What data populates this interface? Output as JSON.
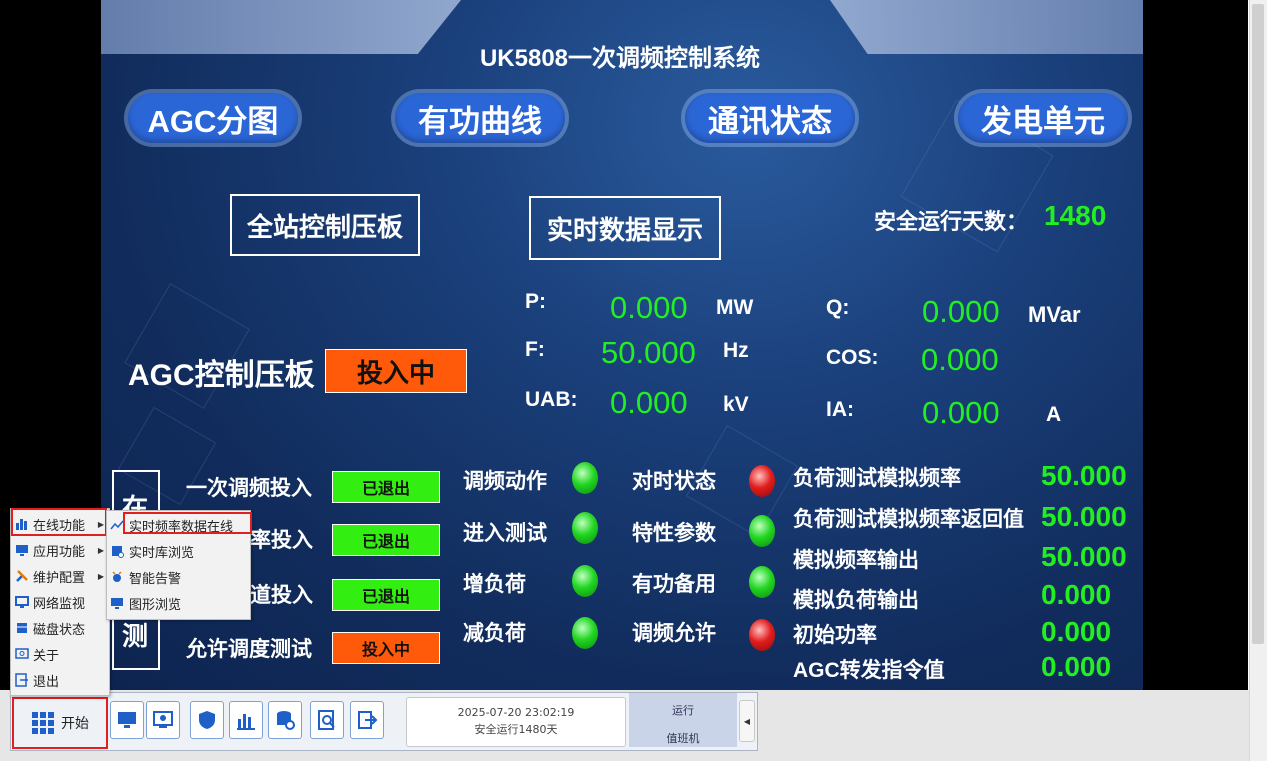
{
  "title": "UK5808一次调频控制系统",
  "nav": [
    "AGC分图",
    "有功曲线",
    "通讯状态",
    "发电单元"
  ],
  "panels": {
    "station_panel": "全站控制压板",
    "realtime_display": "实时数据显示"
  },
  "safe_days": {
    "label": "安全运行天数：",
    "value": "1480"
  },
  "agc": {
    "label": "AGC控制压板",
    "status": "投入中"
  },
  "measurements": {
    "p": {
      "label": "P:",
      "value": "0.000",
      "unit": "MW"
    },
    "f": {
      "label": "F:",
      "value": "50.000",
      "unit": "Hz"
    },
    "uab": {
      "label": "UAB:",
      "value": "0.000",
      "unit": "kV"
    },
    "q": {
      "label": "Q:",
      "value": "0.000",
      "unit": "MVar"
    },
    "cos": {
      "label": "COS:",
      "value": "0.000"
    },
    "ia": {
      "label": "IA:",
      "value": "0.000",
      "unit": "A"
    }
  },
  "vertical_label": [
    "在",
    "测"
  ],
  "switches": [
    {
      "label": "一次调频投入",
      "status": "已退出"
    },
    {
      "label": "率投入",
      "status": "已退出"
    },
    {
      "label": "道投入",
      "status": "已退出"
    },
    {
      "label": "允许调度测试",
      "status": "投入中"
    }
  ],
  "indicators_left": [
    {
      "label": "调频动作",
      "state": "green"
    },
    {
      "label": "进入测试",
      "state": "green"
    },
    {
      "label": "增负荷",
      "state": "green"
    },
    {
      "label": "减负荷",
      "state": "green"
    }
  ],
  "indicators_right": [
    {
      "label": "对时状态",
      "state": "red"
    },
    {
      "label": "特性参数",
      "state": "green"
    },
    {
      "label": "有功备用",
      "state": "green"
    },
    {
      "label": "调频允许",
      "state": "red"
    }
  ],
  "test_values": [
    {
      "label": "负荷测试模拟频率",
      "value": "50.000"
    },
    {
      "label": "负荷测试模拟频率返回值",
      "value": "50.000"
    },
    {
      "label": "模拟频率输出",
      "value": "50.000"
    },
    {
      "label": "模拟负荷输出",
      "value": "0.000"
    },
    {
      "label": "初始功率",
      "value": "0.000"
    },
    {
      "label": "AGC转发指令值",
      "value": "0.000"
    }
  ],
  "start_menu": {
    "items": [
      "在线功能",
      "应用功能",
      "维护配置",
      "网络监视",
      "磁盘状态",
      "关于",
      "退出"
    ],
    "submenu": [
      "实时频率数据在线",
      "实时库浏览",
      "智能告警",
      "图形浏览"
    ]
  },
  "taskbar": {
    "start_label": "开始",
    "datetime": "2025-07-20 23:02:19",
    "safe_run": "安全运行1480天",
    "run_label": "运行",
    "duty_label": "值班机"
  },
  "colors": {
    "status_green": "#33ee11",
    "status_orange": "#ff5a0a",
    "value_green": "#22ee22",
    "accent_blue": "#2b66d6"
  }
}
